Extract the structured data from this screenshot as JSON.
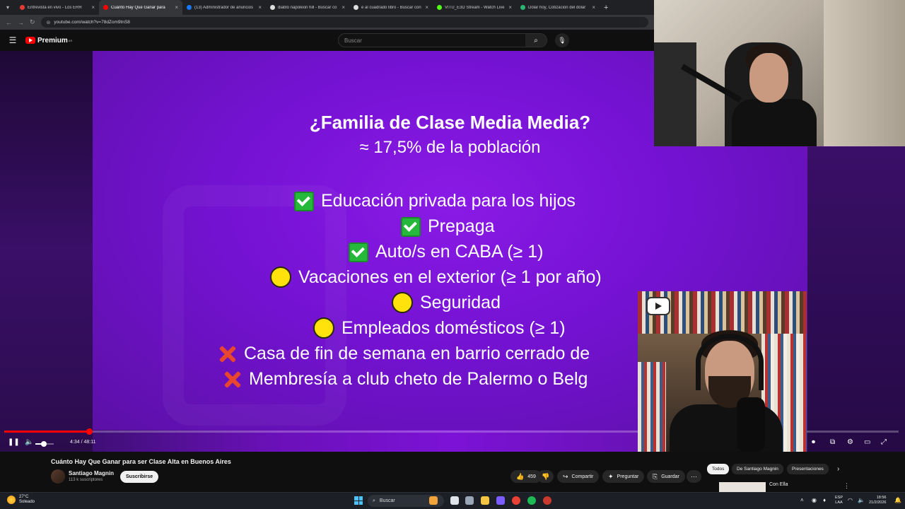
{
  "browser": {
    "tabs": [
      {
        "label": "Entrevista en vivo - Los ERR",
        "color": "#e53935",
        "active": false
      },
      {
        "label": "Cuánto Hay Que Ganar para",
        "color": "#ff0000",
        "active": true
      },
      {
        "label": "(13) Administrador de anuncios",
        "color": "#1877f2",
        "active": false
      },
      {
        "label": "diablo napoleon hill - Buscar co",
        "color": "#dddddd",
        "active": false
      },
      {
        "label": "e al cuadrado libro - Buscar con",
        "color": "#dddddd",
        "active": false
      },
      {
        "label": "VITU_E3D Stream - Watch Live",
        "color": "#53fc18",
        "active": false
      },
      {
        "label": "Dólar hoy, Cotización del dólar",
        "color": "#2bb673",
        "active": false
      }
    ],
    "url": "youtube.com/watch?v=78dZom9tnS8"
  },
  "youtube": {
    "logo_text": "Premium",
    "logo_sup": "AR",
    "search_placeholder": "Buscar"
  },
  "slide": {
    "title": "¿Familia de Clase Media Media?",
    "subtitle": "≈ 17,5% de la población",
    "items": [
      {
        "icon": "check-icon",
        "text": "Educación privada para los hijos"
      },
      {
        "icon": "check-icon",
        "text": "Prepaga"
      },
      {
        "icon": "check-icon",
        "text": "Auto/s en CABA (≥ 1)"
      },
      {
        "icon": "yellow-circle-icon",
        "text": "Vacaciones en el exterior (≥ 1 por año)"
      },
      {
        "icon": "yellow-circle-icon",
        "text": "Seguridad"
      },
      {
        "icon": "yellow-circle-icon",
        "text": "Empleados domésticos (≥ 1)"
      },
      {
        "icon": "cross-icon",
        "text": "Casa de fin de semana en barrio cerrado de"
      },
      {
        "icon": "cross-icon",
        "text": "Membresía a club cheto de Palermo o Belg"
      }
    ],
    "colors": {
      "check": "#26b83a",
      "circle": "#ffe20b",
      "cross": "#e8462e"
    }
  },
  "player": {
    "time": "4:34 / 48:11",
    "progress_fraction": 0.095,
    "volume_fraction": 0.45
  },
  "video_info": {
    "title": "Cuánto Hay Que Ganar para ser Clase Alta en Buenos Aires",
    "channel": "Santiago Magnin",
    "subscribers": "113 k suscriptores",
    "subscribe_label": "Suscribirse",
    "likes": "459",
    "share_label": "Compartir",
    "ask_label": "Preguntar",
    "save_label": "Guardar"
  },
  "recommendations": {
    "chips": [
      "Todos",
      "De Santiago Magnin",
      "Presentaciones"
    ],
    "first_title": "Con Ella"
  },
  "taskbar": {
    "weather_temp": "27°C",
    "weather_desc": "Soleado",
    "search_label": "Buscar",
    "lang_1": "ESP",
    "lang_2": "LAA",
    "time": "18:56",
    "date": "21/2/2026"
  }
}
